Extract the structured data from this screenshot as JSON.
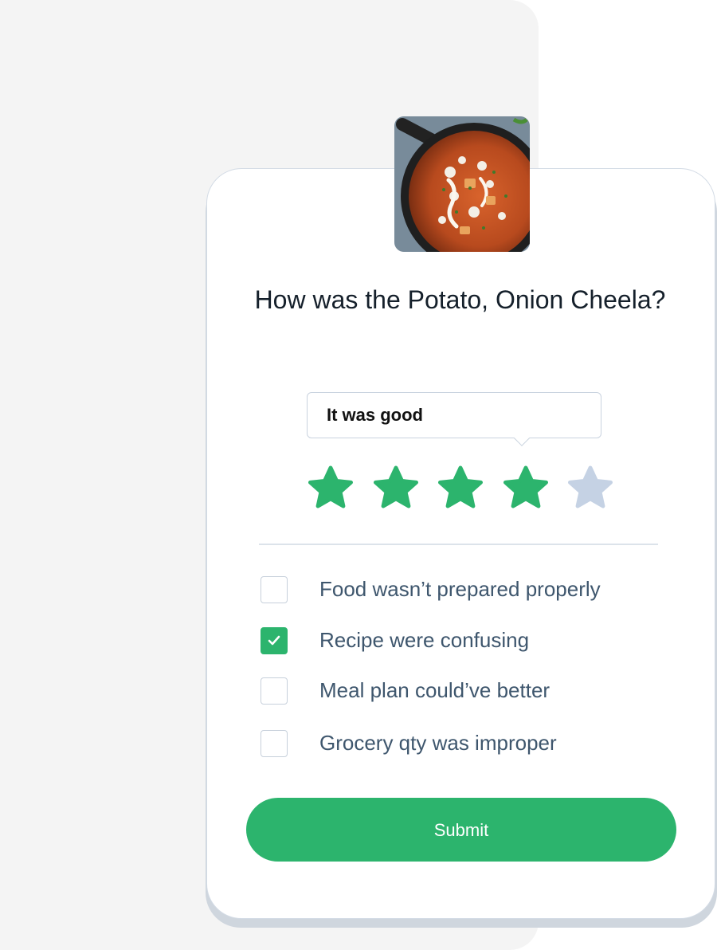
{
  "dish": {
    "question": "How was the Potato, Onion Cheela?",
    "photo_icon": "food-photo"
  },
  "rating": {
    "label": "It was good",
    "value": 4,
    "max": 5,
    "filled_color": "#2cb46d",
    "empty_color": "#c5d2e4"
  },
  "feedback_options": [
    {
      "label": "Food wasn’t prepared properly",
      "checked": false
    },
    {
      "label": "Recipe were confusing",
      "checked": true
    },
    {
      "label": "Meal plan could’ve better",
      "checked": false
    },
    {
      "label": "Grocery qty was improper",
      "checked": false
    }
  ],
  "submit": {
    "label": "Submit"
  },
  "colors": {
    "accent": "#2cb46d",
    "text_dark": "#15202b",
    "text_muted": "#3e566d"
  }
}
